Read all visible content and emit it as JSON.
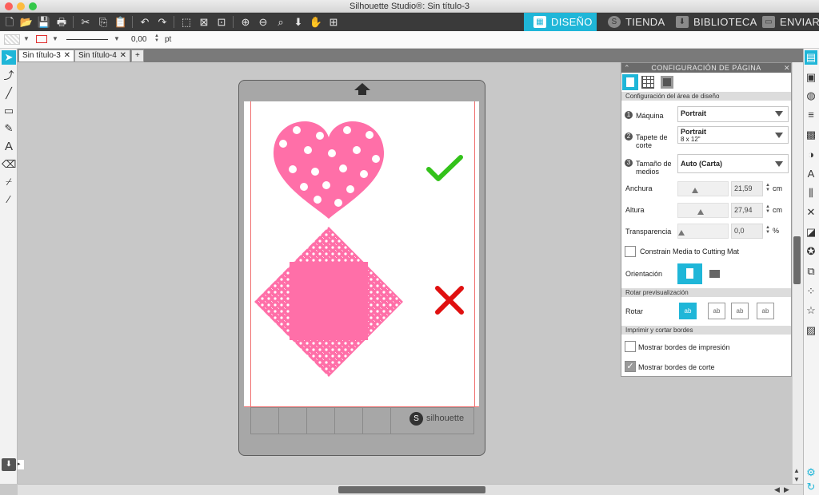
{
  "window": {
    "title": "Silhouette Studio®: Sin título-3"
  },
  "colors": {
    "accent": "#1fb6d8",
    "shape_pink": "#ff6fa8",
    "check_green": "#33c21a",
    "cross_red": "#e01010"
  },
  "nav_tabs": [
    {
      "label": "DISEÑO",
      "icon": "design-icon",
      "active": true
    },
    {
      "label": "TIENDA",
      "icon": "store-icon",
      "active": false
    },
    {
      "label": "BIBLIOTECA",
      "icon": "library-icon",
      "active": false
    },
    {
      "label": "ENVIAR",
      "icon": "send-icon",
      "active": false
    }
  ],
  "options_bar": {
    "line_width": "0,00",
    "unit": "pt"
  },
  "doc_tabs": [
    {
      "label": "Sin título-3",
      "active": true
    },
    {
      "label": "Sin título-4",
      "active": false
    }
  ],
  "add_tab": "+",
  "mat": {
    "brand": "silhouette"
  },
  "panel": {
    "title": "CONFIGURACIÓN DE PÁGINA",
    "section_design": "Configuración del área de diseño",
    "machine": {
      "step": "1",
      "label": "Máquina",
      "value": "Portrait"
    },
    "cutting_mat": {
      "step": "2",
      "label_line1": "Tapete de",
      "label_line2": "corte",
      "value_line1": "Portrait",
      "value_line2": "8 x 12\""
    },
    "media_size": {
      "step": "3",
      "label_line1": "Tamaño de",
      "label_line2": "medios",
      "value": "Auto (Carta)"
    },
    "width": {
      "label": "Anchura",
      "value": "21,59",
      "unit": "cm"
    },
    "height": {
      "label": "Altura",
      "value": "27,94",
      "unit": "cm"
    },
    "transparency": {
      "label": "Transparencia",
      "value": "0,0",
      "unit": "%"
    },
    "constrain": {
      "label": "Constrain Media to Cutting Mat",
      "checked": false
    },
    "orientation": {
      "label": "Orientación"
    },
    "section_rotate": "Rotar previsualización",
    "rotate": {
      "label": "Rotar",
      "options": [
        "ab",
        "ab",
        "ab",
        "ab"
      ]
    },
    "section_borders": "Imprimir y cortar bordes",
    "print_borders": {
      "label": "Mostrar bordes de impresión",
      "checked": false
    },
    "cut_borders": {
      "label": "Mostrar bordes de corte",
      "checked": true
    }
  }
}
